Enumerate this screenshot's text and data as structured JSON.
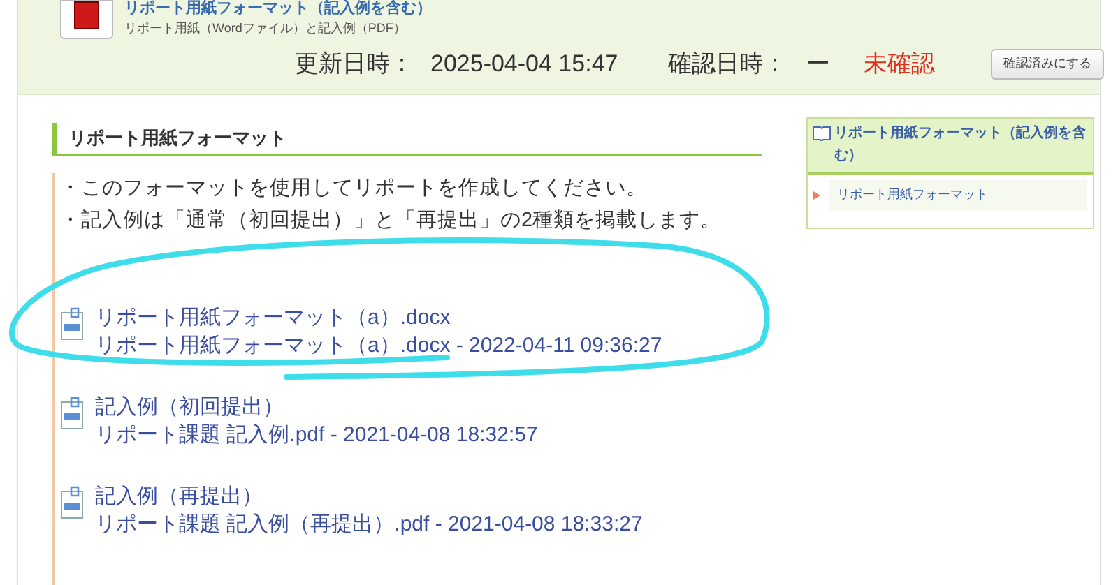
{
  "header": {
    "title": "リポート用紙フォーマット（記入例を含む）",
    "subtitle": "リポート用紙（Wordファイル）と記入例（PDF）",
    "updated_label": "更新日時：",
    "updated_value": "2025-04-04 15:47",
    "confirmed_label": "確認日時：",
    "confirmed_value": "ー",
    "status": "未確認",
    "button": "確認済みにする"
  },
  "section": {
    "heading": "リポート用紙フォーマット",
    "notes": [
      "・このフォーマットを使用してリポートを作成してください。",
      "・記入例は「通常（初回提出）」と「再提出」の2種類を掲載します。"
    ],
    "files": [
      {
        "name": "リポート用紙フォーマット（a）.docx",
        "detail": "リポート用紙フォーマット（a）.docx - 2022-04-11 09:36:27"
      },
      {
        "name": "記入例（初回提出）",
        "detail": "リポート課題 記入例.pdf - 2021-04-08 18:32:57"
      },
      {
        "name": "記入例（再提出）",
        "detail": "リポート課題 記入例（再提出）.pdf - 2021-04-08 18:33:27"
      }
    ]
  },
  "sidebar": {
    "title": "リポート用紙フォーマット（記入例を含む）",
    "items": [
      {
        "label": "リポート用紙フォーマット"
      }
    ]
  }
}
